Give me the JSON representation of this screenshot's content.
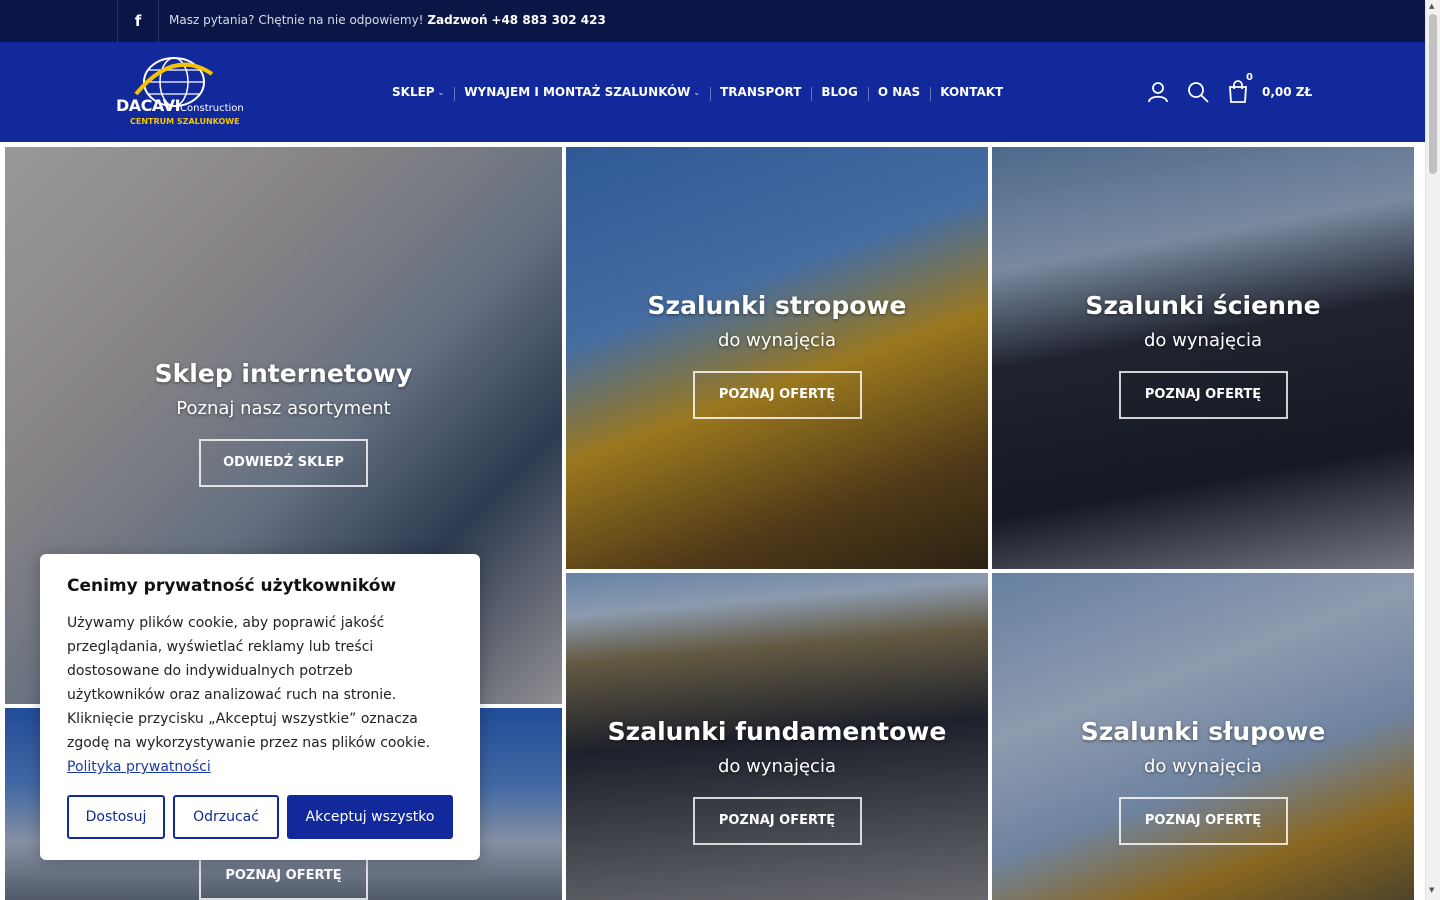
{
  "topbar": {
    "facebook_icon": "facebook-icon",
    "message": "Masz pytania? Chętnie na nie odpowiemy!",
    "call_label": "Zadzwoń",
    "phone": "+48 883 302 423"
  },
  "header": {
    "logo": {
      "name": "DACAVI",
      "suffix": "Construction",
      "tagline": "CENTRUM SZALUNKOWE"
    },
    "nav": [
      {
        "label": "SKLEP",
        "has_dropdown": true
      },
      {
        "label": "WYNAJEM I MONTAŻ SZALUNKÓW",
        "has_dropdown": true
      },
      {
        "label": "TRANSPORT",
        "has_dropdown": false
      },
      {
        "label": "BLOG",
        "has_dropdown": false
      },
      {
        "label": "O NAS",
        "has_dropdown": false
      },
      {
        "label": "KONTAKT",
        "has_dropdown": false
      }
    ],
    "cart_count": "0",
    "cart_total": "0,00 ZŁ",
    "icons": [
      "user-icon",
      "search-icon",
      "shopping-bag-icon"
    ]
  },
  "tiles": [
    {
      "id": "shop",
      "title": "Sklep internetowy",
      "subtitle": "Poznaj nasz asortyment",
      "button": "ODWIEDŹ SKLEP"
    },
    {
      "id": "ceiling",
      "title": "Szalunki stropowe",
      "subtitle": "do wynajęcia",
      "button": "POZNAJ OFERTĘ"
    },
    {
      "id": "wall",
      "title": "Szalunki ścienne",
      "subtitle": "do wynajęcia",
      "button": "POZNAJ OFERTĘ"
    },
    {
      "id": "foundation",
      "title": "Szalunki fundamentowe",
      "subtitle": "do wynajęcia",
      "button": "POZNAJ OFERTĘ"
    },
    {
      "id": "column",
      "title": "Szalunki słupowe",
      "subtitle": "do wynajęcia",
      "button": "POZNAJ OFERTĘ"
    },
    {
      "id": "scaffold",
      "button": "POZNAJ OFERTĘ"
    }
  ],
  "cookie": {
    "title": "Cenimy prywatność użytkowników",
    "text": "Używamy plików cookie, aby poprawić jakość przeglądania, wyświetlać reklamy lub treści dostosowane do indywidualnych potrzeb użytkowników oraz analizować ruch na stronie. Kliknięcie przycisku „Akceptuj wszystkie” oznacza zgodę na wykorzystywanie przez nas plików cookie.",
    "link": "Polityka prywatności",
    "buttons": {
      "customize": "Dostosuj",
      "reject": "Odrzucać",
      "accept": "Akceptuj wszystko"
    }
  },
  "colors": {
    "topbar": "#0b1647",
    "header": "#11299a",
    "accent": "#f5c400"
  }
}
